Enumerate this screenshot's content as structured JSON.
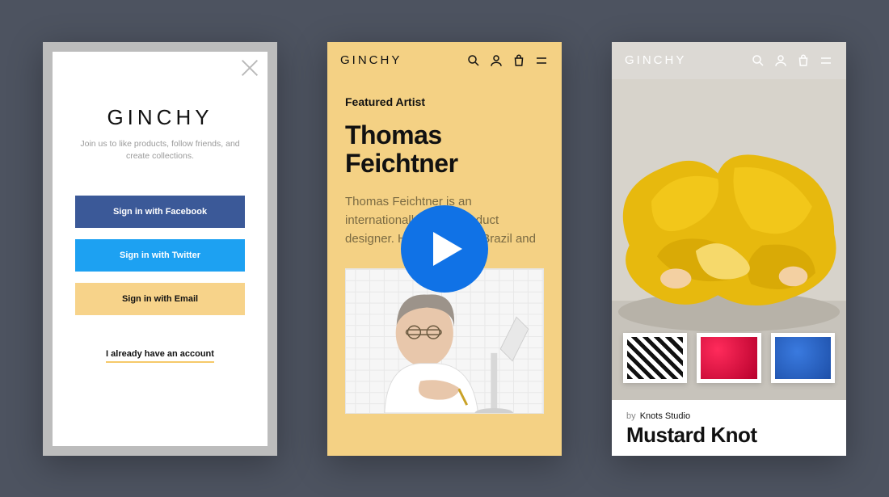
{
  "brand": "GINCHY",
  "screen1": {
    "subtitle": "Join us to like products, follow friends, and create collections.",
    "fb_label": "Sign in with Facebook",
    "tw_label": "Sign in with Twitter",
    "em_label": "Sign in with Email",
    "already_label": "I already have an account"
  },
  "screen2": {
    "featured_label": "Featured Artist",
    "artist_name": "Thomas Feichtner",
    "artist_bio": "Thomas Feichtner is an internationally active product designer. He was born in Brazil and"
  },
  "screen3": {
    "by_label": "by",
    "author": "Knots Studio",
    "product_title": "Mustard Knot"
  }
}
